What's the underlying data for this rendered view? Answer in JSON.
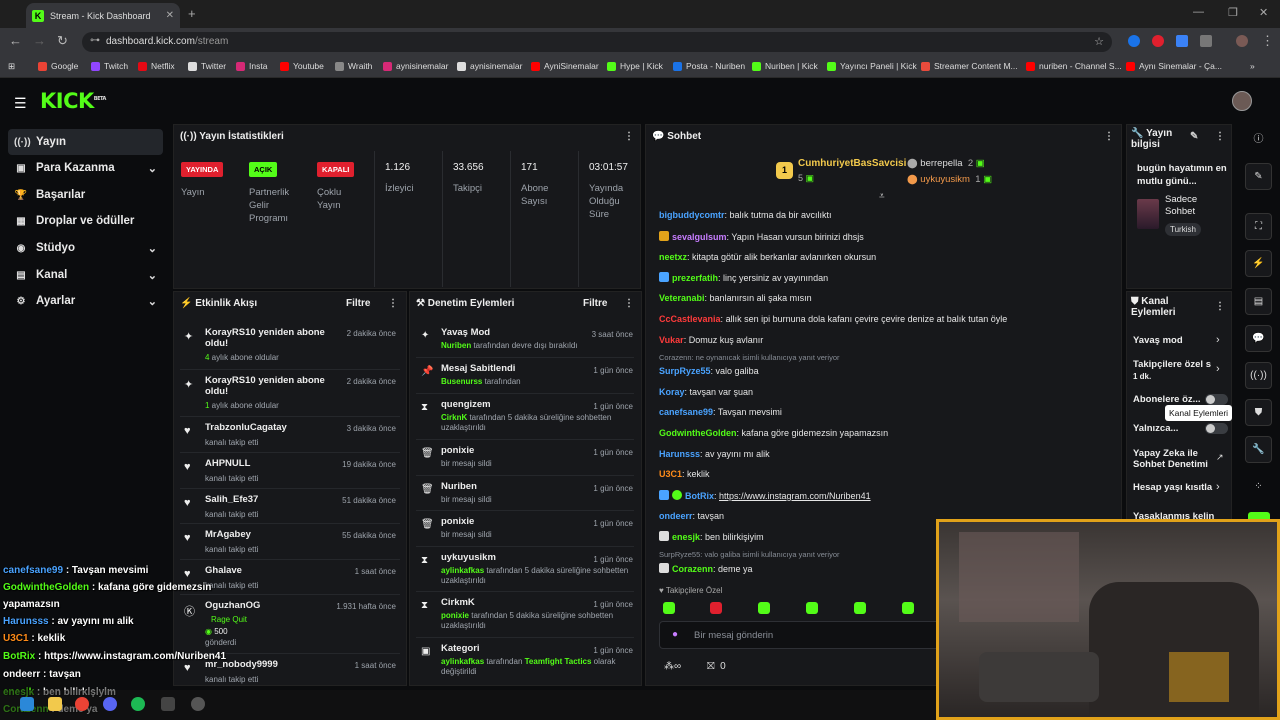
{
  "browser": {
    "tab_title": "Stream - Kick Dashboard",
    "tab_fav": "K",
    "new_tab": "+",
    "url_host": "dashboard.kick.com",
    "url_path": "/stream",
    "bookmarks": [
      {
        "label": "Google",
        "color": "#ea4335"
      },
      {
        "label": "Twitch",
        "color": "#9146ff"
      },
      {
        "label": "Netflix",
        "color": "#e50914"
      },
      {
        "label": "Twitter",
        "color": "#dddddd"
      },
      {
        "label": "Insta",
        "color": "#d62976"
      },
      {
        "label": "Youtube",
        "color": "#ff0000"
      },
      {
        "label": "Wraith",
        "color": "#888888"
      },
      {
        "label": "aynisinemalar",
        "color": "#d62976"
      },
      {
        "label": "aynisinemalar",
        "color": "#dddddd"
      },
      {
        "label": "AyniSinemalar",
        "color": "#ff0000"
      },
      {
        "label": "Hype | Kick",
        "color": "#53fc18"
      },
      {
        "label": "Posta - Nuriben",
        "color": "#1a73e8"
      },
      {
        "label": "Nuriben | Kick",
        "color": "#53fc18"
      },
      {
        "label": "Yayıncı Paneli | Kick",
        "color": "#53fc18"
      },
      {
        "label": "Streamer Content M...",
        "color": "#e94b3c"
      },
      {
        "label": "nuriben - Channel S...",
        "color": "#ff0000"
      },
      {
        "label": "Aynı Sinemalar - Ça...",
        "color": "#ff0000"
      }
    ]
  },
  "header": {
    "logo": "KICK",
    "logo_beta": "BETA"
  },
  "sidebar": {
    "items": [
      {
        "label": "Yayın",
        "icon": "((·))"
      },
      {
        "label": "Para Kazanma",
        "icon": "▣"
      },
      {
        "label": "Başarılar",
        "icon": "🏆"
      },
      {
        "label": "Droplar ve ödüller",
        "icon": "▦"
      },
      {
        "label": "Stüdyo",
        "icon": "◉"
      },
      {
        "label": "Kanal",
        "icon": "▤"
      },
      {
        "label": "Ayarlar",
        "icon": "⚙"
      }
    ]
  },
  "stats": {
    "title": "Yayın İstatistikleri",
    "yayin_badge": "YAYINDA",
    "yayin_label": "Yayın",
    "partner_badge": "AÇIK",
    "partner_label": "Partnerlik Gelir Programı",
    "coklu_badge": "KAPALI",
    "coklu_label": "Çoklu Yayın",
    "viewers": "1.126",
    "viewers_label": "İzleyici",
    "followers": "33.656",
    "followers_label": "Takipçi",
    "subs": "171",
    "subs_label": "Abone Sayısı",
    "duration": "03:01:57",
    "duration_label": "Yayında Olduğu Süre"
  },
  "activity": {
    "title": "Etkinlik Akışı",
    "filter": "Filtre",
    "items": [
      {
        "name": "KorayRS10 yeniden abone oldu!",
        "sub_prefix": "4",
        "sub": " aylık abone oldular",
        "time": "2 dakika önce"
      },
      {
        "name": "KorayRS10 yeniden abone oldu!",
        "sub_prefix": "1",
        "sub": " aylık abone oldular",
        "time": "2 dakika önce"
      },
      {
        "name": "TrabzonluCagatay",
        "sub": "kanalı takip etti",
        "time": "3 dakika önce"
      },
      {
        "name": "AHPNULL",
        "sub": "kanalı takip etti",
        "time": "19 dakika önce"
      },
      {
        "name": "Salih_Efe37",
        "sub": "kanalı takip etti",
        "time": "51 dakika önce"
      },
      {
        "name": "MrAgabey",
        "sub": "kanalı takip etti",
        "time": "55 dakika önce"
      },
      {
        "name": "Ghalave",
        "sub": "kanalı takip etti",
        "time": "1 saat önce"
      },
      {
        "name": "OguzhanOG",
        "sub_green": "Rage Quit",
        "sub_amount": "500",
        "sub": "gönderdi",
        "time": "1.931 hafta önce"
      },
      {
        "name": "mr_nobody9999",
        "sub": "kanalı takip etti",
        "time": "1 saat önce"
      }
    ]
  },
  "moderation": {
    "title": "Denetim Eylemleri",
    "filter": "Filtre",
    "items": [
      {
        "name": "Yavaş Mod",
        "user": "Nuriben",
        "text": " tarafından devre dışı bırakıldı",
        "time": "3 saat önce"
      },
      {
        "name": "Mesaj Sabitlendi",
        "user": "Busenurss",
        "text": " tarafından",
        "time": "1 gün önce"
      },
      {
        "name": "quengizem",
        "user": "CirknK",
        "text": " tarafından 5 dakika süreliğine sohbetten uzaklaştırıldı",
        "time": "1 gün önce"
      },
      {
        "name": "ponixie",
        "user": "",
        "text": "bir mesajı sildi",
        "time": "1 gün önce"
      },
      {
        "name": "Nuriben",
        "user": "",
        "text": "bir mesajı sildi",
        "time": "1 gün önce"
      },
      {
        "name": "ponixie",
        "user": "",
        "text": "bir mesajı sildi",
        "time": "1 gün önce"
      },
      {
        "name": "uykuyusikm",
        "user": "aylinkafkas",
        "text": " tarafından 5 dakika süreliğine sohbetten uzaklaştırıldı",
        "time": "1 gün önce"
      },
      {
        "name": "CirkmK",
        "user": "ponixie",
        "text": " tarafından 5 dakika süreliğine sohbetten uzaklaştırıldı",
        "time": "1 gün önce"
      },
      {
        "name": "Kategori",
        "user": "aylinkafkas",
        "text": " tarafından ",
        "user2": "Teamfight Tactics",
        "text2": " olarak değiştirildi",
        "time": "1 gün önce"
      }
    ]
  },
  "chat": {
    "title": "Sohbet",
    "top_gifter": "CumhuriyetBasSavcisi",
    "top_gifter_count": "5",
    "gifter2": "berrepella",
    "gifter2_count": "2",
    "gifter3": "uykuyusikm",
    "gifter3_count": "1",
    "messages": [
      {
        "user": "bigbuddycomtr",
        "color": "#4aa3ff",
        "text": "balık tutma da bir avcılıktı"
      },
      {
        "user": "sevalgulsum",
        "color": "#c77dff",
        "text": "Yapın Hasan vursun birinizi dhsjs"
      },
      {
        "user": "neetxz",
        "color": "#53fc18",
        "text": "kitapta götür alik berkanlar avlanırken okursun"
      },
      {
        "user": "prezerfatih",
        "color": "#53fc18",
        "text": "linç yersiniz av yayınından"
      },
      {
        "user": "Veteranabi",
        "color": "#53fc18",
        "text": "banlanırsın ali şaka mısın"
      },
      {
        "user": "CcCastlevania",
        "color": "#ff3b3b",
        "text": "allık sen ipi burnuna dola kafanı çevire çevire denize at balık tutan öyle"
      },
      {
        "user": "Vukar",
        "color": "#ff3b3b",
        "text": "Domuz kuş avlanır"
      },
      {
        "user": "SurpRyze55",
        "color": "#4aa3ff",
        "text": "valo galiba",
        "reply": "Corazenn: ne oynanıcak isimli kullanıcıya yanıt veriyor"
      },
      {
        "user": "Koray",
        "color": "#4aa3ff",
        "text": "tavşan var şuan"
      },
      {
        "user": "canefsane99",
        "color": "#4aa3ff",
        "text": "Tavşan mevsimi"
      },
      {
        "user": "GodwintheGolden",
        "color": "#53fc18",
        "text": "kafana göre gidemezsin yapamazsın"
      },
      {
        "user": "Harunsss",
        "color": "#4aa3ff",
        "text": "av yayını mı alik"
      },
      {
        "user": "U3C1",
        "color": "#ff8c1a",
        "text": "keklik"
      },
      {
        "user": "BotRix",
        "color": "#4aa3ff",
        "text": "https://www.instagram.com/Nuriben41"
      },
      {
        "user": "ondeerr",
        "color": "#4aa3ff",
        "text": "tavşan"
      },
      {
        "user": "enesjk",
        "color": "#53fc18",
        "text": "ben bilirkişiyim"
      },
      {
        "user": "Corazenn",
        "color": "#53fc18",
        "text": "deme ya",
        "reply": "SurpRyze55: valo galiba isimli kullanıcıya yanıt veriyor"
      }
    ],
    "followers_only": "Takipçilere Özel",
    "input_placeholder": "Bir mesaj gönderin",
    "footer_count": "0"
  },
  "stream_info": {
    "title": "Yayın bilgisi",
    "stream_title": "bugün hayatımın en mutlu günü...",
    "category": "Sadece Sohbet",
    "language": "Turkish"
  },
  "channel_actions": {
    "title": "Kanal Eylemleri",
    "slow_mode": "Yavaş mod",
    "followers_only": "Takipçilere özel s",
    "followers_only_val": "1 dk.",
    "subs_only": "Abonelere öz...",
    "emotes_only": "Yalnızca...",
    "ai_mod": "Yapay Zeka ile Sohbet Denetimi",
    "age_restrict": "Hesap yaşı kısıtla",
    "banned_words": "Yasaklanmış kelin"
  },
  "tooltip": "Kanal Eylemleri",
  "overlay_chat": [
    {
      "user": "canefsane99",
      "color": "#4aa3ff",
      "text": " : Tavşan mevsimi"
    },
    {
      "user": "GodwintheGolden",
      "color": "#53fc18",
      "text": " : kafana göre gidemezsin"
    },
    {
      "user": "",
      "color": "#fff",
      "text": "yapamazsın"
    },
    {
      "user": "Harunsss",
      "color": "#4aa3ff",
      "text": " : av yayını mı alik"
    },
    {
      "user": "U3C1",
      "color": "#ff8c1a",
      "text": " : keklik"
    },
    {
      "user": "BotRix",
      "color": "#53fc18",
      "text": " : https://www.instagram.com/Nuriben41"
    },
    {
      "user": "ondeerr",
      "color": "#fff",
      "text": " : tavşan"
    },
    {
      "user": "enesjk",
      "color": "#53fc18",
      "text": " : ben bilirkişiyim"
    },
    {
      "user": "Corazenn",
      "color": "#53fc18",
      "text": " : deme ya"
    }
  ],
  "colors": {
    "accent": "#53fc18",
    "red": "#e0202e",
    "webcam_border": "#e1a21a"
  }
}
